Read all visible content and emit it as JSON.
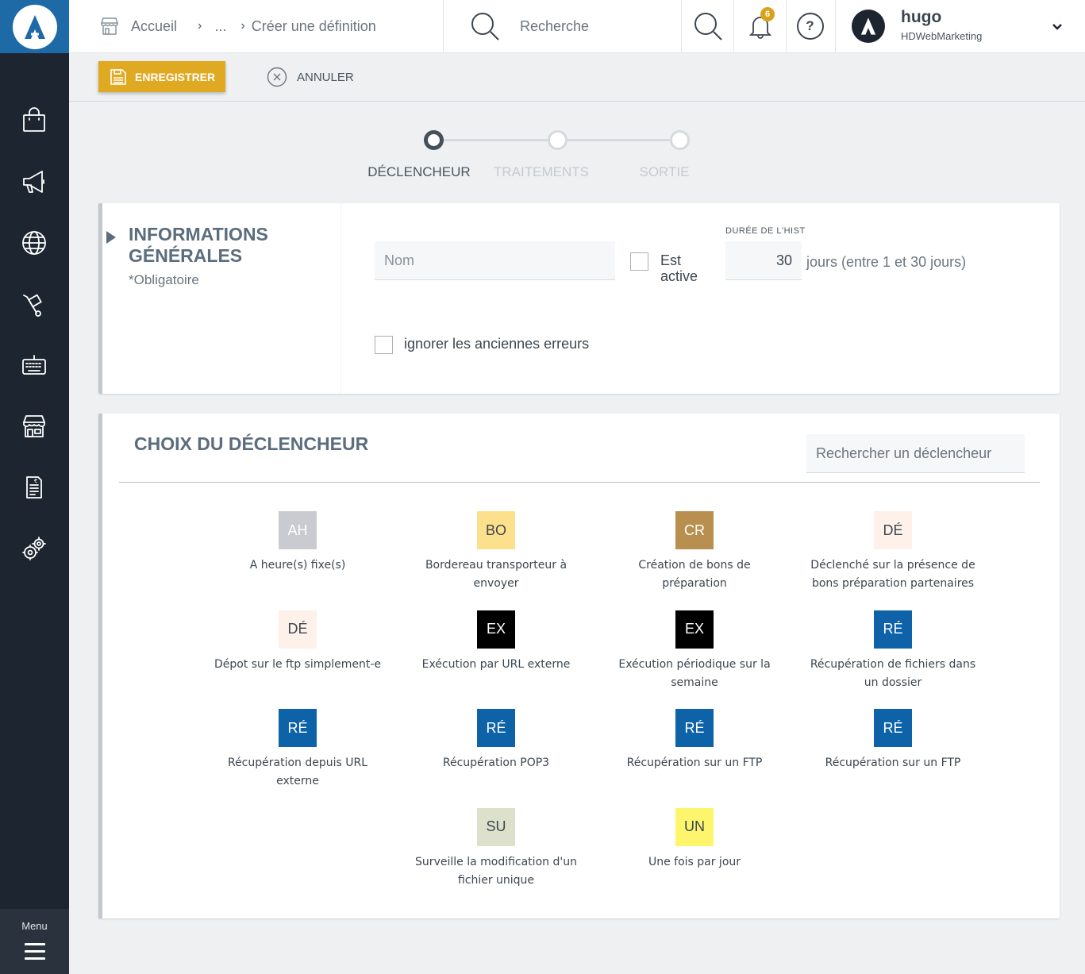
{
  "header": {
    "breadcrumb": [
      {
        "label": "Accueil"
      },
      {
        "label": "..."
      },
      {
        "label": "Créer une définition"
      }
    ],
    "search_placeholder": "Recherche",
    "notifications_count": "6",
    "help_label": "?",
    "user": {
      "name": "hugo",
      "org": "HDWebMarketing"
    }
  },
  "sidebar": {
    "items": [
      {
        "icon": "shopping-bag-icon"
      },
      {
        "icon": "megaphone-icon"
      },
      {
        "icon": "globe-icon"
      },
      {
        "icon": "hand-truck-icon"
      },
      {
        "icon": "keyboard-icon"
      },
      {
        "icon": "store-icon"
      },
      {
        "icon": "invoice-icon"
      },
      {
        "icon": "gears-icon"
      }
    ],
    "menu_label": "Menu"
  },
  "toolbar": {
    "save_label": "ENREGISTRER",
    "cancel_label": "ANNULER"
  },
  "stepper": {
    "steps": [
      {
        "label": "DÉCLENCHEUR",
        "active": true
      },
      {
        "label": "TRAITEMENTS",
        "active": false
      },
      {
        "label": "SORTIE",
        "active": false
      }
    ]
  },
  "general_info": {
    "title": "INFORMATIONS GÉNÉRALES",
    "subtitle": "*Obligatoire",
    "name_placeholder": "Nom",
    "active_label": "Est active",
    "duration_label": "DURÉE DE L'HIST",
    "duration_value": "30",
    "duration_unit": "jours (entre 1 et 30 jours)",
    "ignore_label": "ignorer les anciennes erreurs"
  },
  "trigger_choice": {
    "title": "CHOIX DU DÉCLENCHEUR",
    "search_placeholder": "Rechercher un déclencheur",
    "items": [
      {
        "code": "AH",
        "label": "A heure(s) fixe(s)",
        "bg": "#c9cbd0",
        "fg": "#ffffff"
      },
      {
        "code": "BO",
        "label": "Bordereau transporteur à envoyer",
        "bg": "#fde08c",
        "fg": "#3c4650"
      },
      {
        "code": "CR",
        "label": "Création de bons de préparation",
        "bg": "#b88f4f",
        "fg": "#ffffff"
      },
      {
        "code": "DÉ",
        "label": "Déclenché sur la présence de bons préparation partenaires",
        "bg": "#fdf1ea",
        "fg": "#3c4650"
      },
      {
        "code": "DÉ",
        "label": "Dépot sur le ftp simplement-e",
        "bg": "#fdf1ea",
        "fg": "#3c4650"
      },
      {
        "code": "EX",
        "label": "Exécution par URL externe",
        "bg": "#000000",
        "fg": "#ffffff"
      },
      {
        "code": "EX",
        "label": "Exécution périodique sur la semaine",
        "bg": "#000000",
        "fg": "#ffffff"
      },
      {
        "code": "RÉ",
        "label": "Récupération de fichiers dans un dossier",
        "bg": "#0e62a8",
        "fg": "#ffffff"
      },
      {
        "code": "RÉ",
        "label": "Récupération depuis URL externe",
        "bg": "#0e62a8",
        "fg": "#ffffff"
      },
      {
        "code": "RÉ",
        "label": "Récupération POP3",
        "bg": "#0e62a8",
        "fg": "#ffffff"
      },
      {
        "code": "RÉ",
        "label": "Récupération sur un FTP",
        "bg": "#0e62a8",
        "fg": "#ffffff"
      },
      {
        "code": "RÉ",
        "label": "Récupération sur un FTP",
        "bg": "#0e62a8",
        "fg": "#ffffff"
      },
      {
        "code": "SU",
        "label": "Surveille la modification d'un fichier unique",
        "bg": "#dde0cb",
        "fg": "#3c4650"
      },
      {
        "code": "UN",
        "label": "Une fois par jour",
        "bg": "#fdf56b",
        "fg": "#3c4650"
      }
    ]
  },
  "colors": {
    "sidebar_bg": "#1d2530",
    "logo_bg": "#1e6aa6",
    "save_button": "#e0a922",
    "title_color": "#5b6c7d",
    "badge": "#d9a21a"
  }
}
